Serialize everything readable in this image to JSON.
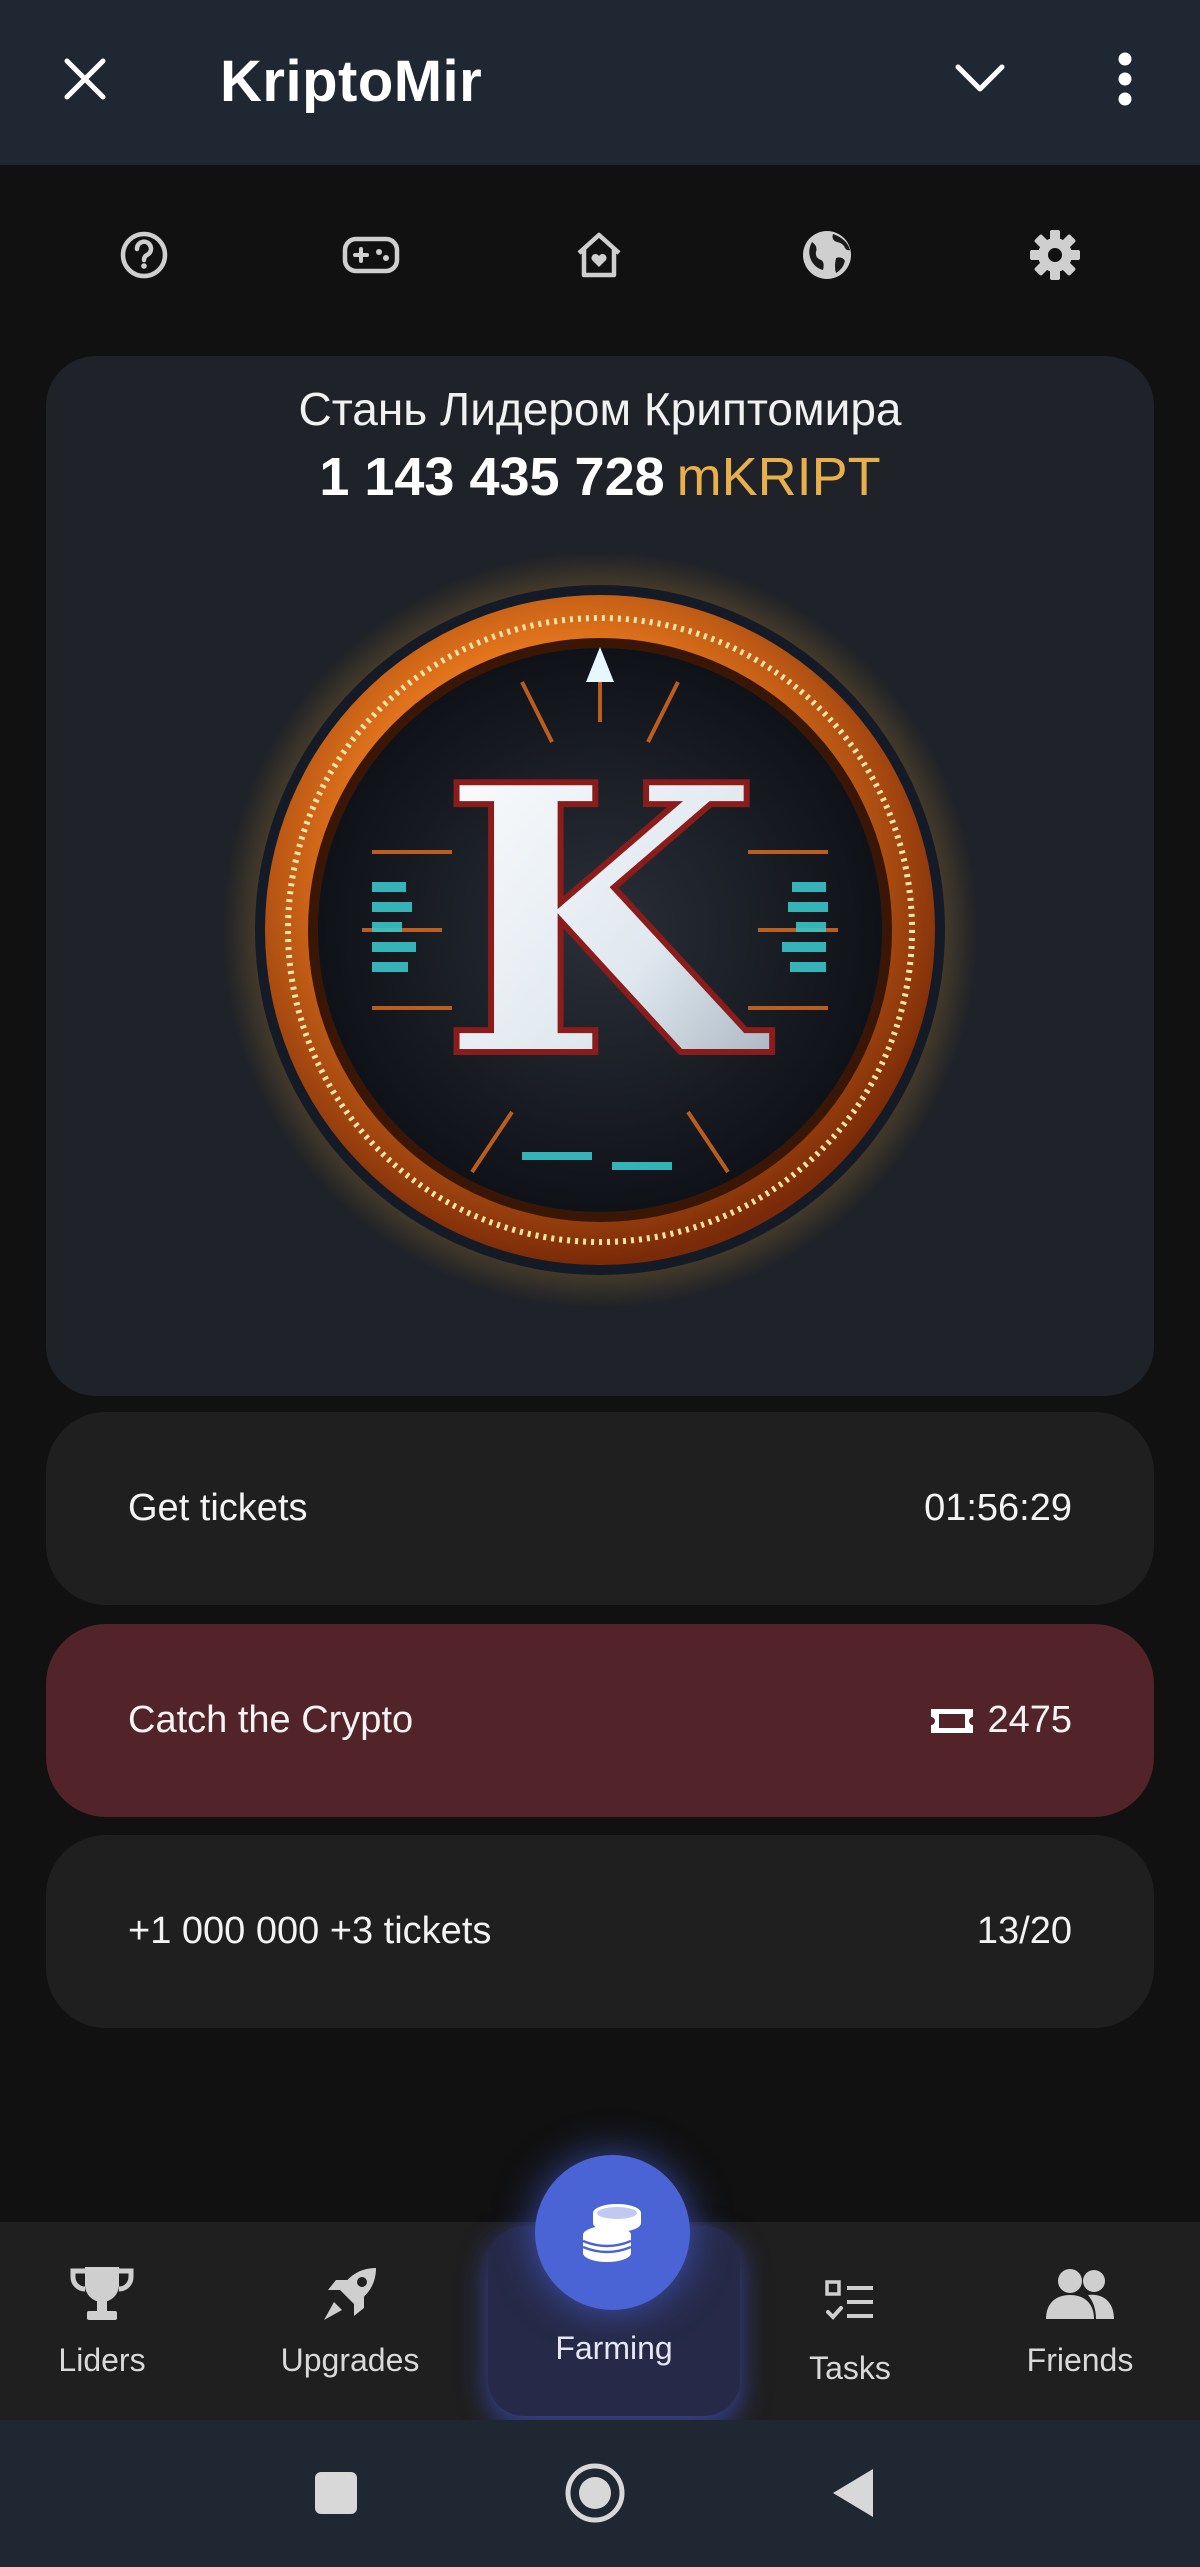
{
  "appbar": {
    "title": "KriptoMir"
  },
  "icons": {
    "close": "close-icon",
    "chevron": "chevron-down-icon",
    "more": "more-vertical-icon",
    "row": [
      "help-icon",
      "gamepad-icon",
      "home-heart-icon",
      "globe-icon",
      "gear-icon"
    ]
  },
  "card": {
    "headline": "Стань Лидером Криптомира",
    "amount": "1 143 435 728",
    "unit": "mKRIPT",
    "coin_letter": "K"
  },
  "rows": [
    {
      "label": "Get tickets",
      "value": "01:56:29"
    },
    {
      "label": "Catch the Crypto",
      "value": "2475"
    },
    {
      "label": "+1 000 000 +3 tickets",
      "value": "13/20"
    }
  ],
  "tabs": [
    {
      "label": "Liders",
      "icon": "trophy-icon"
    },
    {
      "label": "Upgrades",
      "icon": "rocket-icon"
    },
    {
      "label": "Farming",
      "icon": "coins-icon",
      "active": true
    },
    {
      "label": "Tasks",
      "icon": "tasks-icon"
    },
    {
      "label": "Friends",
      "icon": "friends-icon"
    }
  ],
  "colors": {
    "appbar": "#1f2733",
    "background": "#111111",
    "card": "#1f2228",
    "row": "#1f1f1f",
    "row_highlight": "#522328",
    "unit_accent": "#e8b04a",
    "farming_accent": "#4a64d6"
  }
}
